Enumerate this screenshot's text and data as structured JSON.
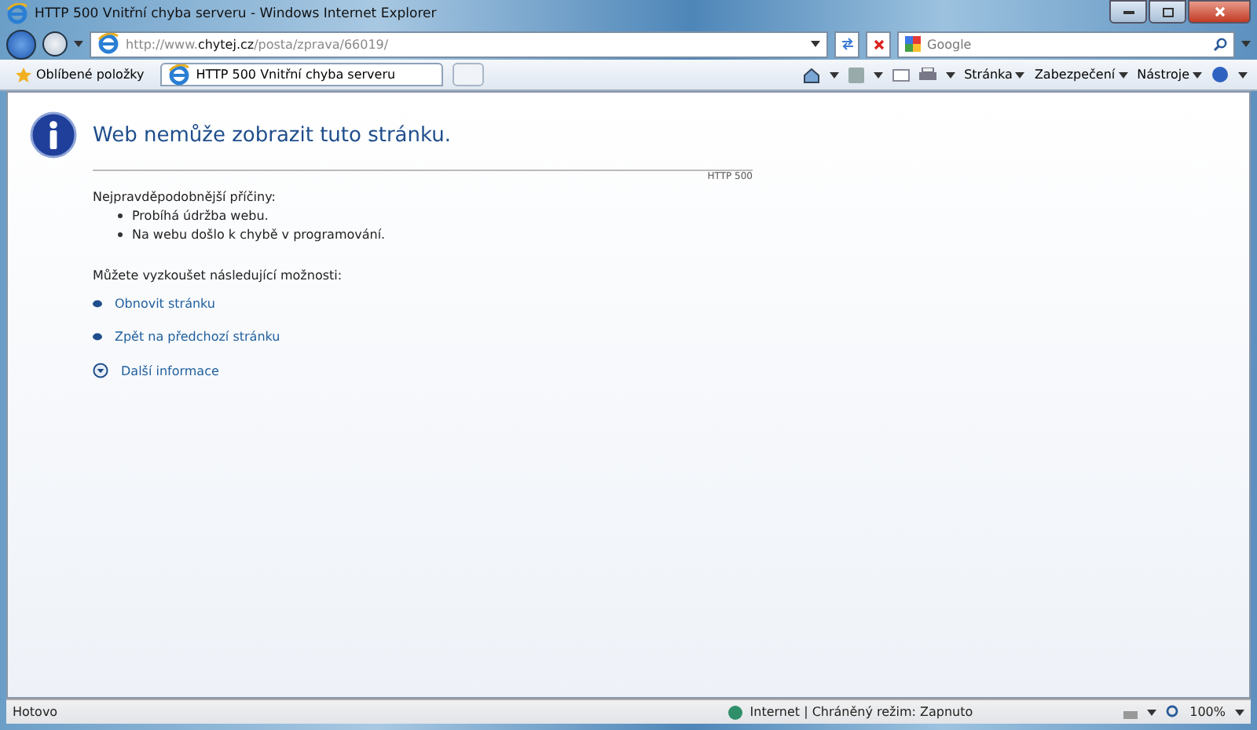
{
  "window": {
    "title": "HTTP 500 Vnitřní chyba serveru - Windows Internet Explorer"
  },
  "address_bar": {
    "url": "http://www.**chytej.cz**/posta/zprava/66019/"
  },
  "search": {
    "placeholder": "Google"
  },
  "favorites": {
    "label": "Oblíbené položky"
  },
  "tabs": [
    {
      "label": "HTTP 500 Vnitřní chyba serveru",
      "selected": true
    }
  ],
  "command_bar": [
    "Stránka",
    "Zabezpečení",
    "Nástroje"
  ],
  "page": {
    "heading": "Web nemůže zobrazit tuto stránku.",
    "code": "HTTP 500",
    "causes_title": "Nejpravděpodobnější příčiny:",
    "causes": [
      "Probíhá údržba webu.",
      "Na webu došlo k chybě v programování."
    ],
    "options_title": "Můžete vyzkoušet následující možnosti:",
    "options": [
      {
        "kind": "bullet",
        "label": "Obnovit stránku"
      },
      {
        "kind": "bullet",
        "label": "Zpět na předchozí stránku"
      },
      {
        "kind": "expand",
        "label": "Další informace"
      }
    ]
  },
  "status_bar": {
    "status": "Hotovo",
    "zone": "Internet | Chráněný režim: Zapnuto",
    "zoom": "100%"
  }
}
